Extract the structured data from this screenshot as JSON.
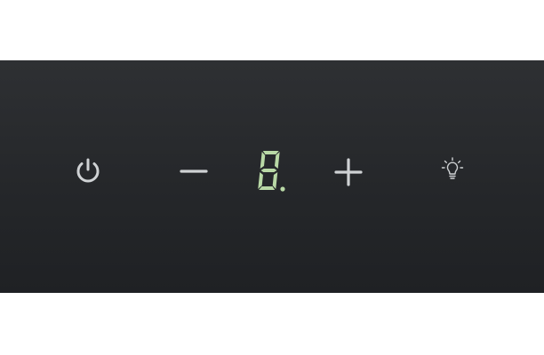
{
  "controls": {
    "power": {
      "icon": "power-icon"
    },
    "decrease": {
      "icon": "minus-icon"
    },
    "increase": {
      "icon": "plus-icon"
    },
    "light": {
      "icon": "light-bulb-icon"
    }
  },
  "display": {
    "value": "8",
    "decimal_point": true,
    "color": "#b9d9a6"
  },
  "colors": {
    "panel": "#26282b",
    "icon": "#cfd2d4"
  }
}
